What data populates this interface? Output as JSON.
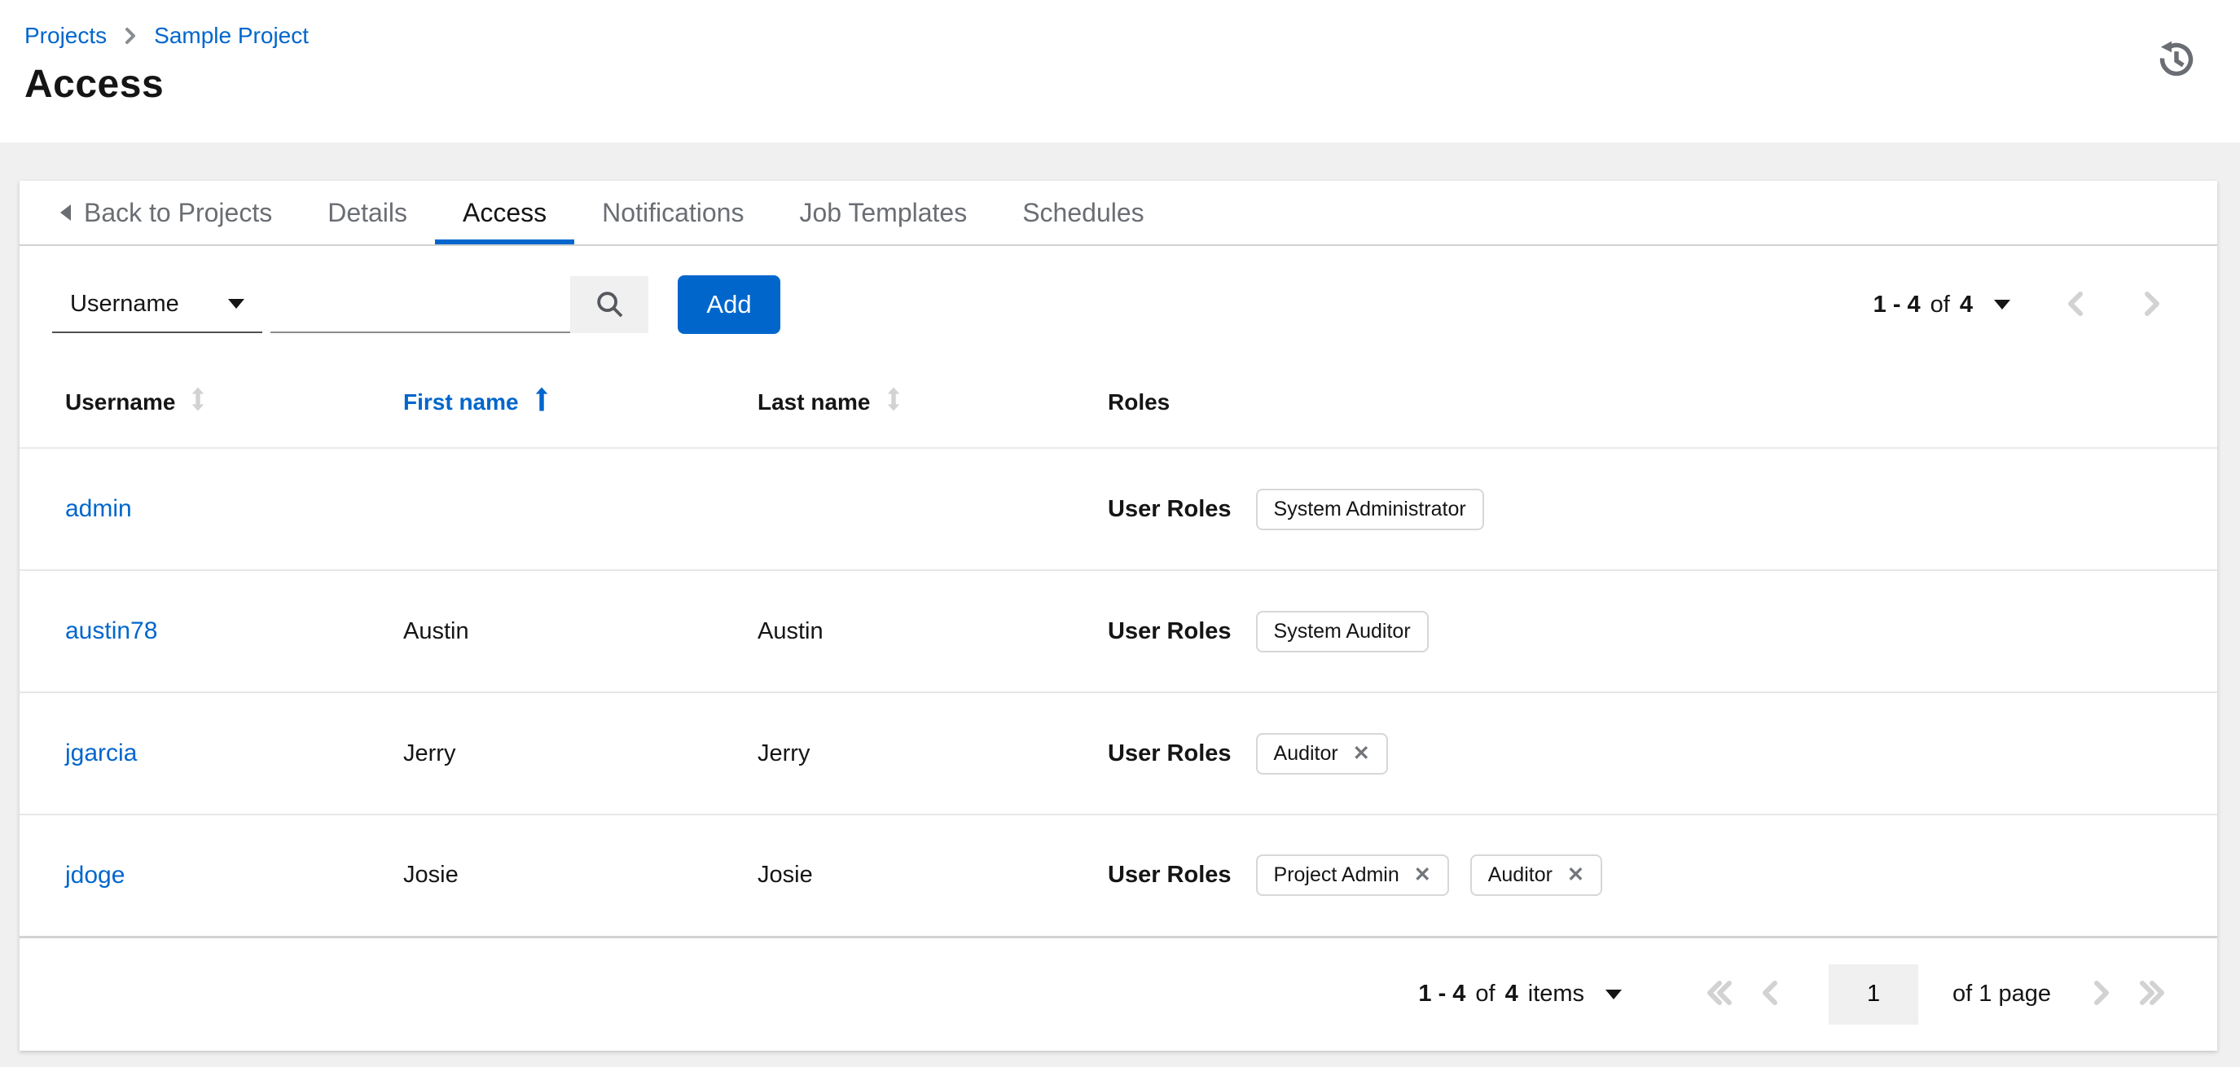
{
  "colors": {
    "accent": "#0066cc",
    "text": "#151515",
    "muted_text": "#6a6e73",
    "disabled": "#d2d2d2",
    "page_background": "#f0f0f0",
    "chip_border": "#d7d7d7"
  },
  "icons": {
    "history": "history-icon (counterclockwise clock arrow)",
    "search": "magnifier",
    "caret": "▾",
    "back": "◂",
    "breadcrumb_separator": "›",
    "sort_unsorted": "↕",
    "sort_ascending": "↑",
    "prev": "‹",
    "next": "›",
    "first": "«",
    "last": "»",
    "chip_close": "✕"
  },
  "breadcrumb": {
    "items": [
      "Projects",
      "Sample Project"
    ]
  },
  "page_title": "Access",
  "tabs": {
    "back_label": "Back to Projects",
    "items": [
      {
        "label": "Details",
        "active": false
      },
      {
        "label": "Access",
        "active": true
      },
      {
        "label": "Notifications",
        "active": false
      },
      {
        "label": "Job Templates",
        "active": false
      },
      {
        "label": "Schedules",
        "active": false
      }
    ]
  },
  "toolbar": {
    "filter_selected": "Username",
    "search_value": "",
    "search_placeholder": "",
    "add_label": "Add",
    "pagination": {
      "range": "1 - 4",
      "of_word": "of",
      "total": "4"
    }
  },
  "table": {
    "columns": [
      {
        "label": "Username",
        "sort": "none"
      },
      {
        "label": "First name",
        "sort": "asc"
      },
      {
        "label": "Last name",
        "sort": "none"
      },
      {
        "label": "Roles",
        "sort": null
      }
    ],
    "roles_label": "User Roles",
    "rows": [
      {
        "username": "admin",
        "first": "",
        "last": "",
        "roles": [
          {
            "name": "System Administrator",
            "removable": false
          }
        ]
      },
      {
        "username": "austin78",
        "first": "Austin",
        "last": "Austin",
        "roles": [
          {
            "name": "System Auditor",
            "removable": false
          }
        ]
      },
      {
        "username": "jgarcia",
        "first": "Jerry",
        "last": "Jerry",
        "roles": [
          {
            "name": "Auditor",
            "removable": true
          }
        ]
      },
      {
        "username": "jdoge",
        "first": "Josie",
        "last": "Josie",
        "roles": [
          {
            "name": "Project Admin",
            "removable": true
          },
          {
            "name": "Auditor",
            "removable": true
          }
        ]
      }
    ]
  },
  "footer_pagination": {
    "range": "1 - 4",
    "of_word": "of",
    "total": "4",
    "items_word": "items",
    "page_value": "1",
    "page_of_label": "of 1 page"
  }
}
